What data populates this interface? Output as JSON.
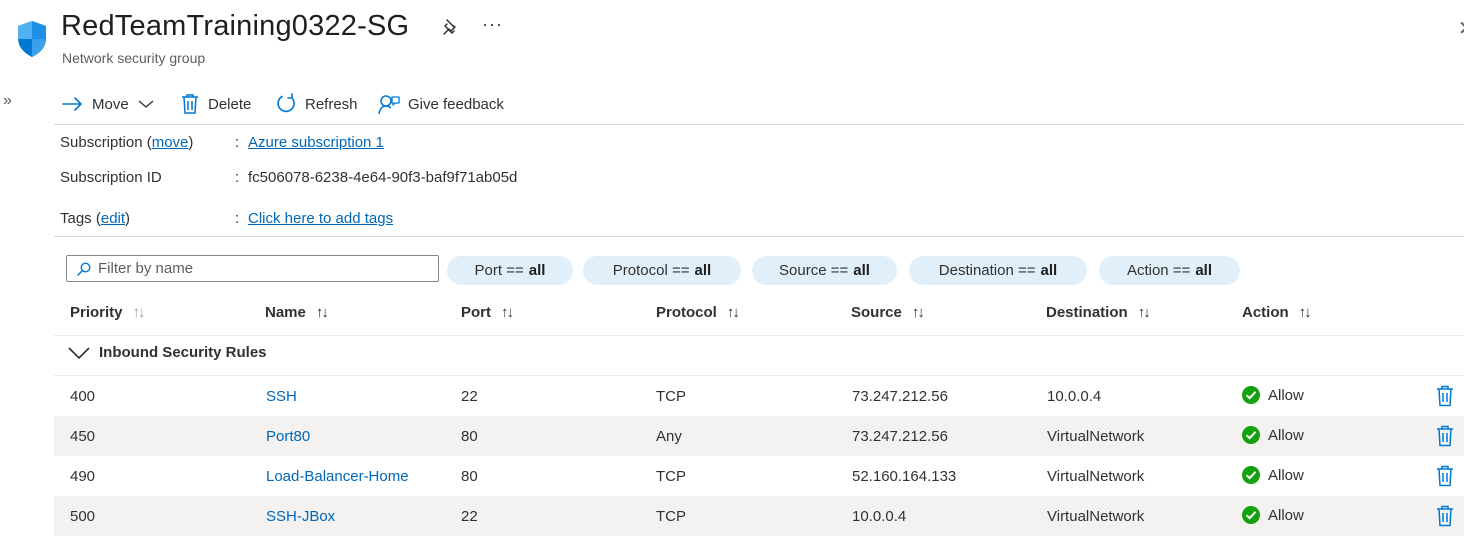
{
  "header": {
    "title": "RedTeamTraining0322-SG",
    "subtitle": "Network security group",
    "more_label": "···",
    "close_label": "✕",
    "expand_label": "»"
  },
  "toolbar": {
    "move_label": "Move",
    "delete_label": "Delete",
    "refresh_label": "Refresh",
    "feedback_label": "Give feedback"
  },
  "essentials": {
    "subscription_label": "Subscription (",
    "subscription_move": "move",
    "subscription_close": ")",
    "subscription_value": "Azure subscription 1",
    "subscription_id_label": "Subscription ID",
    "subscription_id_value": "fc506078-6238-4e64-90f3-baf9f71ab05d",
    "tags_label": "Tags (",
    "tags_edit": "edit",
    "tags_close": ")",
    "tags_value": "Click here to add tags",
    "colon": ":"
  },
  "filter": {
    "placeholder": "Filter by name",
    "pills": [
      {
        "label": "Port ==",
        "value": "all"
      },
      {
        "label": "Protocol ==",
        "value": "all"
      },
      {
        "label": "Source ==",
        "value": "all"
      },
      {
        "label": "Destination ==",
        "value": "all"
      },
      {
        "label": "Action ==",
        "value": "all"
      }
    ]
  },
  "table": {
    "columns": [
      "Priority",
      "Name",
      "Port",
      "Protocol",
      "Source",
      "Destination",
      "Action"
    ],
    "sort_icon": "↑↓",
    "group_label": "Inbound Security Rules",
    "rows": [
      {
        "priority": "400",
        "name": "SSH",
        "port": "22",
        "protocol": "TCP",
        "source": "73.247.212.56",
        "destination": "10.0.0.4",
        "action": "Allow"
      },
      {
        "priority": "450",
        "name": "Port80",
        "port": "80",
        "protocol": "Any",
        "source": "73.247.212.56",
        "destination": "VirtualNetwork",
        "action": "Allow"
      },
      {
        "priority": "490",
        "name": "Load-Balancer-Home",
        "port": "80",
        "protocol": "TCP",
        "source": "52.160.164.133",
        "destination": "VirtualNetwork",
        "action": "Allow"
      },
      {
        "priority": "500",
        "name": "SSH-JBox",
        "port": "22",
        "protocol": "TCP",
        "source": "10.0.0.4",
        "destination": "VirtualNetwork",
        "action": "Allow"
      }
    ]
  },
  "colors": {
    "accent": "#0078d4",
    "link": "#0067b8",
    "allow_green": "#13a10e",
    "pill_bg": "#e1effa"
  },
  "icons": {
    "shield": "shield-icon",
    "pin": "pin-icon",
    "move": "arrow-right-icon",
    "delete": "trash-icon",
    "refresh": "refresh-icon",
    "feedback": "feedback-icon",
    "search": "search-icon",
    "allow": "check-circle-icon"
  }
}
